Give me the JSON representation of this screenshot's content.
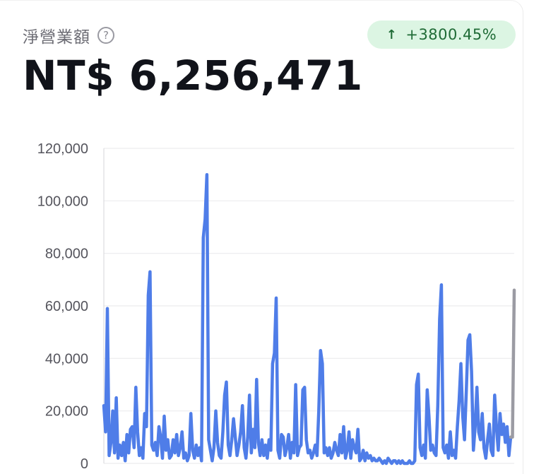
{
  "header": {
    "title": "淨營業額",
    "help_icon": "?",
    "change_badge": {
      "arrow": "↑",
      "text": "+3800.45%",
      "color": "#dcf5e3",
      "text_color": "#1f6b36"
    },
    "total_value": "NT$ 6,256,471"
  },
  "chart_data": {
    "type": "line",
    "ylim": [
      0,
      120000
    ],
    "y_ticks": [
      {
        "value": 0,
        "label": "0"
      },
      {
        "value": 20000,
        "label": "20,000"
      },
      {
        "value": 40000,
        "label": "40,000"
      },
      {
        "value": 60000,
        "label": "60,000"
      },
      {
        "value": 80000,
        "label": "80,000"
      },
      {
        "value": 100000,
        "label": "100,000"
      },
      {
        "value": 120000,
        "label": "120,000"
      }
    ],
    "grid": true,
    "series": [
      {
        "color": "#4f7de8",
        "values": [
          22000,
          12000,
          59000,
          3000,
          8000,
          20000,
          4000,
          25000,
          2000,
          7000,
          3000,
          8000,
          1000,
          11000,
          4000,
          13000,
          14000,
          6000,
          29000,
          12000,
          3000,
          6000,
          2000,
          19000,
          14000,
          64000,
          73000,
          7000,
          5000,
          8000,
          3000,
          14000,
          10000,
          2000,
          18000,
          5000,
          9000,
          2000,
          3000,
          9000,
          4000,
          11000,
          3000,
          6000,
          12000,
          2000,
          4000,
          1000,
          3000,
          19000,
          5000,
          2000,
          7000,
          3000,
          6000,
          1000,
          86000,
          93000,
          110000,
          9000,
          5000,
          1000,
          6000,
          20000,
          8000,
          3000,
          2000,
          12000,
          26000,
          31000,
          7000,
          3000,
          9000,
          17000,
          10000,
          3000,
          7000,
          12000,
          22000,
          6000,
          2000,
          10000,
          26000,
          4000,
          13000,
          6000,
          32000,
          8000,
          3000,
          9000,
          3000,
          7000,
          2000,
          9000,
          5000,
          38000,
          42000,
          63000,
          5000,
          2000,
          11000,
          10000,
          3000,
          6000,
          11000,
          2000,
          8000,
          4000,
          30000,
          3000,
          6000,
          7000,
          28000,
          29000,
          9000,
          4000,
          5000,
          2000,
          4000,
          7000,
          3000,
          20000,
          43000,
          38000,
          4000,
          6000,
          3000,
          6000,
          2000,
          4000,
          8000,
          5000,
          3000,
          11000,
          4000,
          14000,
          2000,
          5000,
          12000,
          2000,
          9000,
          6000,
          4000,
          13000,
          1000,
          2000,
          5000,
          1000,
          4000,
          2000,
          3000,
          1000,
          2000,
          1000,
          1000,
          2000,
          1000,
          0,
          1000,
          0,
          2000,
          1000,
          0,
          1000,
          1000,
          0,
          1000,
          0,
          1000,
          0,
          0,
          0,
          1000,
          0,
          0,
          1000,
          30000,
          34000,
          6000,
          3000,
          7000,
          2000,
          28000,
          18000,
          5000,
          7000,
          4000,
          3000,
          22000,
          55000,
          68000,
          6000,
          4000,
          7000,
          2000,
          12000,
          3000,
          5000,
          2000,
          14000,
          24000,
          38000,
          18000,
          9000,
          27000,
          47000,
          49000,
          35000,
          5000,
          14000,
          29000,
          12000,
          9000,
          19000,
          6000,
          2000,
          9000,
          15000,
          5000,
          3000,
          26000,
          14000,
          5000,
          19000,
          11000,
          15000,
          8000,
          14000,
          3000,
          10000
        ],
        "partial_tail": {
          "color": "#9b9ba3",
          "values": [
            10000,
            66000
          ]
        }
      }
    ]
  }
}
